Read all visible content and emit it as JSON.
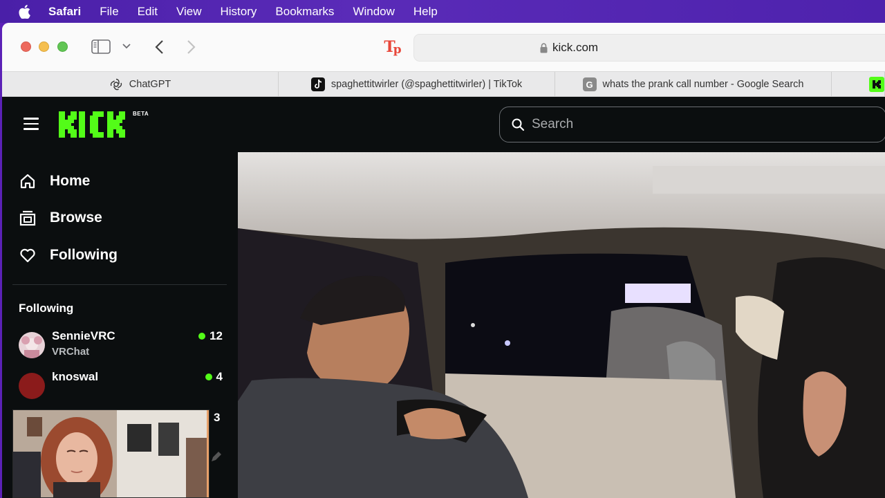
{
  "menubar": {
    "app_name": "Safari",
    "items": [
      "File",
      "Edit",
      "View",
      "History",
      "Bookmarks",
      "Window",
      "Help"
    ]
  },
  "toolbar": {
    "url": "kick.com"
  },
  "tabs": [
    {
      "label": "ChatGPT",
      "icon": "chatgpt-icon"
    },
    {
      "label": "spaghettitwirler (@spaghettitwirler) | TikTok",
      "icon": "tiktok-icon"
    },
    {
      "label": "whats the prank call number - Google Search",
      "icon": "google-icon"
    },
    {
      "label": "",
      "icon": "kick-icon"
    }
  ],
  "kick": {
    "logo_text": "KICK",
    "beta_label": "BETA",
    "search_placeholder": "Search",
    "nav": [
      {
        "label": "Home",
        "icon": "home-icon"
      },
      {
        "label": "Browse",
        "icon": "browse-icon"
      },
      {
        "label": "Following",
        "icon": "heart-icon"
      }
    ],
    "following_heading": "Following",
    "channels": [
      {
        "name": "SennieVRC",
        "category": "VRChat",
        "viewers": "12"
      },
      {
        "name": "knoswal",
        "category": "",
        "viewers": "4"
      },
      {
        "name": "",
        "category": "",
        "viewers": "3"
      }
    ]
  },
  "colors": {
    "kick_green": "#53fc18",
    "menubar_purple": "#4a1fa8",
    "page_bg": "#0b0e0f"
  }
}
